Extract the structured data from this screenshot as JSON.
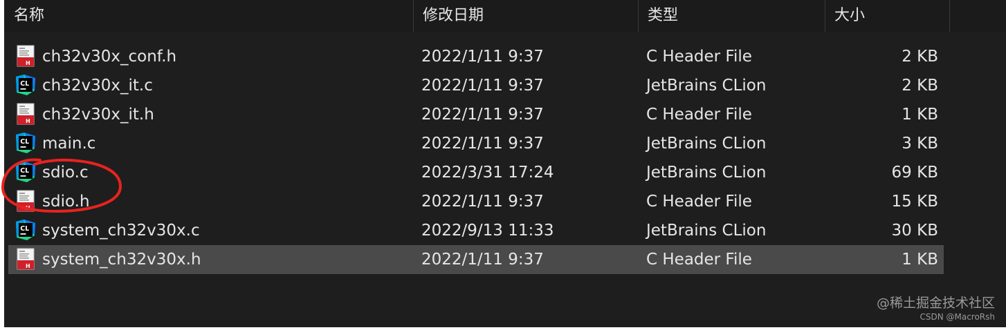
{
  "columns": {
    "name": "名称",
    "date": "修改日期",
    "type": "类型",
    "size": "大小"
  },
  "sort_indicator": "^",
  "files": [
    {
      "name": "ch32v30x_conf.h",
      "date": "2022/1/11 9:37",
      "type": "C Header File",
      "size": "2 KB",
      "icon": "h-file-icon",
      "selected": false
    },
    {
      "name": "ch32v30x_it.c",
      "date": "2022/1/11 9:37",
      "type": "JetBrains CLion",
      "size": "2 KB",
      "icon": "clion-icon",
      "selected": false
    },
    {
      "name": "ch32v30x_it.h",
      "date": "2022/1/11 9:37",
      "type": "C Header File",
      "size": "1 KB",
      "icon": "h-file-icon",
      "selected": false
    },
    {
      "name": "main.c",
      "date": "2022/1/11 9:37",
      "type": "JetBrains CLion",
      "size": "3 KB",
      "icon": "clion-icon",
      "selected": false
    },
    {
      "name": "sdio.c",
      "date": "2022/3/31 17:24",
      "type": "JetBrains CLion",
      "size": "69 KB",
      "icon": "clion-icon",
      "selected": false
    },
    {
      "name": "sdio.h",
      "date": "2022/1/11 9:37",
      "type": "C Header File",
      "size": "15 KB",
      "icon": "h-file-icon",
      "selected": false
    },
    {
      "name": "system_ch32v30x.c",
      "date": "2022/9/13 11:33",
      "type": "JetBrains CLion",
      "size": "30 KB",
      "icon": "clion-icon",
      "selected": false
    },
    {
      "name": "system_ch32v30x.h",
      "date": "2022/1/11 9:37",
      "type": "C Header File",
      "size": "1 KB",
      "icon": "h-file-icon",
      "selected": true
    }
  ],
  "icon_labels": {
    "clion": "CL",
    "h_file": "H"
  },
  "watermark": {
    "line1": "@稀土掘金技术社区",
    "line2": "CSDN @MacroRsh"
  },
  "colors": {
    "background": "#1e1e1e",
    "selected_row": "#4a4a4a",
    "annotation": "#e8231e",
    "clion_green": "#21d789",
    "header_file_red": "#d0202a"
  }
}
